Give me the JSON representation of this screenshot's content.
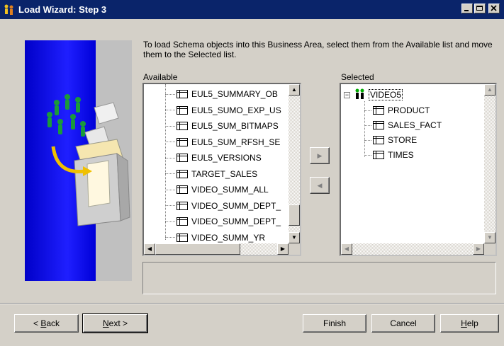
{
  "window": {
    "title": "Load Wizard: Step 3",
    "minimize_icon": "minimize-icon",
    "maximize_icon": "maximize-icon",
    "close_icon": "close-icon",
    "app_icon": "wizard-app-icon"
  },
  "instructions": "To load Schema objects into this Business Area, select them from the Available list and move them to the Selected list.",
  "available": {
    "label": "Available",
    "items": [
      "EUL5_SUMMARY_OB",
      "EUL5_SUMO_EXP_US",
      "EUL5_SUM_BITMAPS",
      "EUL5_SUM_RFSH_SE",
      "EUL5_VERSIONS",
      "TARGET_SALES",
      "VIDEO_SUMM_ALL",
      "VIDEO_SUMM_DEPT_",
      "VIDEO_SUMM_DEPT_",
      "VIDEO_SUMM_YR"
    ]
  },
  "selected": {
    "label": "Selected",
    "root": "VIDEO5",
    "root_toggle": "−",
    "items": [
      "PRODUCT",
      "SALES_FACT",
      "STORE",
      "TIMES"
    ]
  },
  "move": {
    "right_icon": "arrow-right-icon",
    "left_icon": "arrow-left-icon"
  },
  "buttons": {
    "back_prefix": "< ",
    "back_key": "B",
    "back_rest": "ack",
    "next_key": "N",
    "next_rest": "ext >",
    "finish": "Finish",
    "cancel": "Cancel",
    "help_key": "H",
    "help_rest": "elp"
  },
  "colors": {
    "titlebar": "#0a246a",
    "face": "#d4d0c8",
    "art_blue": "#1f1fff"
  }
}
